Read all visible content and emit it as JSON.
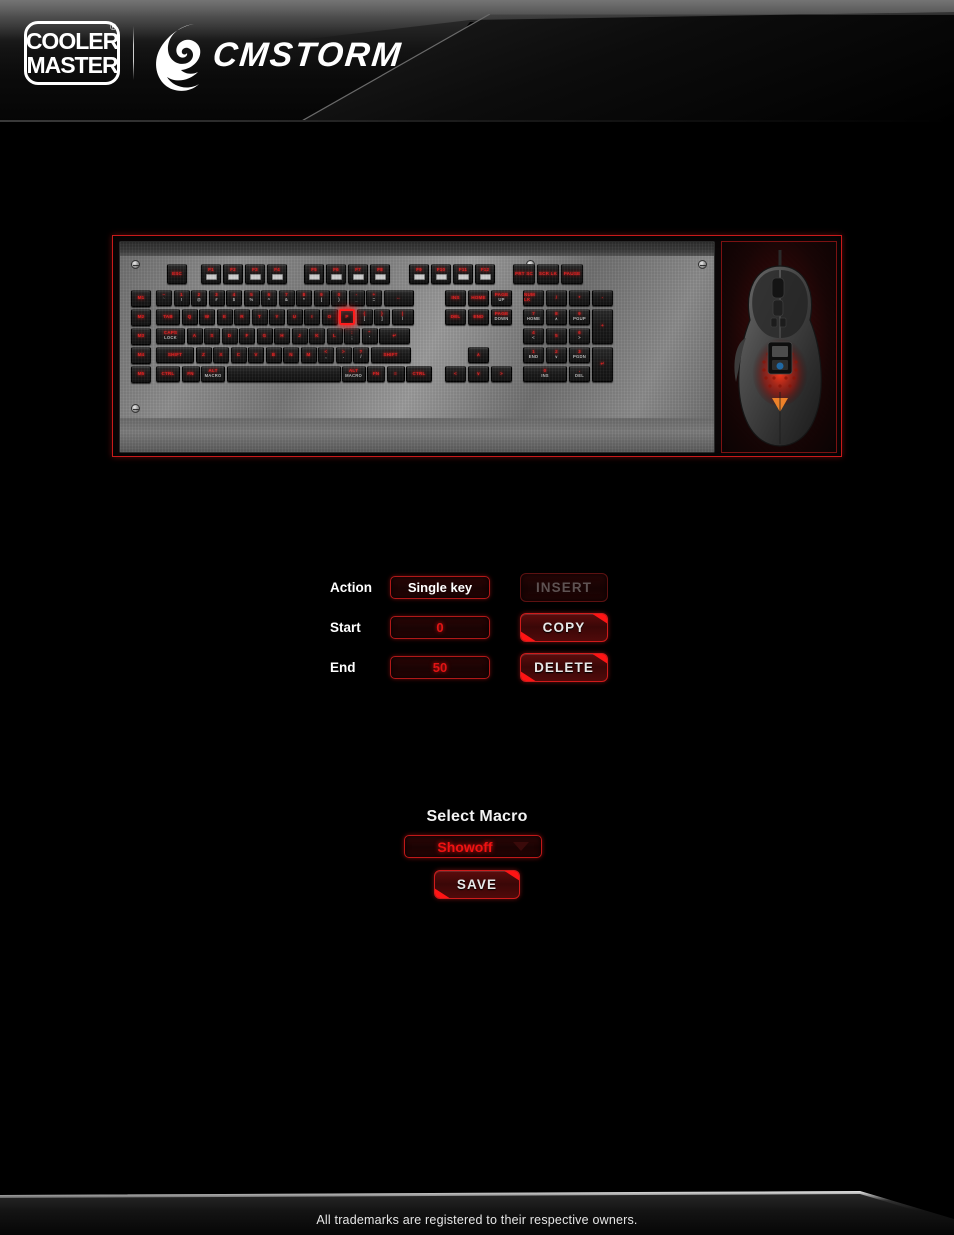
{
  "header": {
    "brand_line1": "COOLER",
    "brand_line2": "MASTER",
    "registered_mark": "®",
    "sub_brand": "CMSTORM",
    "logo_icon": "cm-storm-swirl-icon"
  },
  "device_preview": {
    "keyboard_name": "mechanical-keyboard-preview",
    "mouse_name": "gaming-mouse-preview",
    "selected_key": "P",
    "macro_keys": [
      "M1",
      "M2",
      "M3",
      "M4",
      "M5"
    ],
    "rows": {
      "fn_row": [
        "ESC",
        "F1",
        "F2",
        "F3",
        "F4",
        "F5",
        "F6",
        "F7",
        "F8",
        "F9",
        "F10",
        "F11",
        "F12",
        "PRT SC",
        "SCR LK",
        "PAUSE"
      ],
      "number_row": [
        "~",
        "1",
        "2",
        "3",
        "4",
        "5",
        "6",
        "7",
        "8",
        "9",
        "0",
        "-",
        "+",
        "BACKSPACE"
      ],
      "number_row_sub": [
        "`",
        "!",
        "@",
        "#",
        "$",
        "%",
        "^",
        "&",
        "*",
        "(",
        ")",
        "_",
        "="
      ],
      "tab_row": [
        "TAB",
        "Q",
        "W",
        "E",
        "R",
        "T",
        "Y",
        "U",
        "I",
        "O",
        "P",
        "{",
        "}",
        "|"
      ],
      "tab_row_sub": [
        "[",
        "]",
        "\\"
      ],
      "caps_row": [
        "CAPS LOCK",
        "A",
        "S",
        "D",
        "F",
        "G",
        "H",
        "J",
        "K",
        "L",
        ":",
        "\"",
        "ENTER"
      ],
      "caps_row_sub": [
        ";",
        "'"
      ],
      "shift_row": [
        "SHIFT",
        "Z",
        "X",
        "C",
        "V",
        "B",
        "N",
        "M",
        "<",
        ">",
        "?",
        "SHIFT"
      ],
      "shift_row_sub": [
        ",",
        ".",
        "/"
      ],
      "bottom_row": [
        "CTRL",
        "FN",
        "ALT MACRO",
        "",
        "ALT MACRO",
        "FN",
        "MENU",
        "CTRL"
      ],
      "nav_cluster": [
        "INS",
        "HOME",
        "PAGE UP",
        "DEL",
        "END",
        "PAGE DOWN"
      ],
      "arrows": [
        "∧",
        "<",
        "∨",
        ">"
      ],
      "numpad": [
        "NUM LK",
        "/",
        "*",
        "-",
        "7",
        "8",
        "9",
        "+",
        "4",
        "5",
        "6",
        "1",
        "2",
        "3",
        "ENTER",
        "0",
        "."
      ],
      "numpad_sub": [
        "HOME",
        "∧",
        "PGUP",
        "<",
        ">",
        "END",
        "∨",
        "PGDN",
        "INS",
        "DEL"
      ]
    }
  },
  "macro_editor": {
    "fields": [
      {
        "label": "Action",
        "value": "Single key",
        "style": "white",
        "name": "action-field"
      },
      {
        "label": "Start",
        "value": "0",
        "style": "red",
        "name": "start-field"
      },
      {
        "label": "End",
        "value": "50",
        "style": "red",
        "name": "end-field"
      }
    ],
    "buttons": [
      {
        "label": "INSERT",
        "enabled": false,
        "name": "insert-button"
      },
      {
        "label": "COPY",
        "enabled": true,
        "name": "copy-button"
      },
      {
        "label": "DELETE",
        "enabled": true,
        "name": "delete-button"
      }
    ]
  },
  "macro_selector": {
    "title": "Select Macro",
    "selected": "Showoff",
    "save_label": "SAVE",
    "dropdown_icon": "chevron-down-icon"
  },
  "footer": {
    "text": "All trademarks are registered to their respective owners."
  },
  "colors": {
    "accent_red": "#e01414",
    "bright_red": "#ff1414",
    "background": "#000000",
    "text_white": "#f2f2f2"
  }
}
